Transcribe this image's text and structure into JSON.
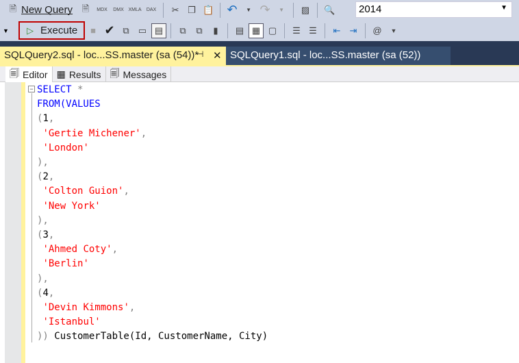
{
  "toolbar": {
    "new_query": "New Query",
    "mdx": "MDX",
    "dmx": "DMX",
    "xmla": "XMLA",
    "dax": "DAX",
    "database": "2014",
    "execute": "Execute"
  },
  "tabs": [
    {
      "label": "SQLQuery2.sql - loc...SS.master (sa (54))*",
      "active": true
    },
    {
      "label": "SQLQuery1.sql - loc...SS.master (sa (52))",
      "active": false
    }
  ],
  "subtabs": [
    "Editor",
    "Results",
    "Messages"
  ],
  "code": {
    "l1a": "SELECT",
    "l1b": " *",
    "l2": "FROM(VALUES",
    "r1id": "1",
    "r1name": "'Gertie Michener'",
    "r1city": "'London'",
    "r2id": "2",
    "r2name": "'Colton Guion'",
    "r2city": "'New York'",
    "r3id": "3",
    "r3name": "'Ahmed Coty'",
    "r3city": "'Berlin'",
    "r4id": "4",
    "r4name": "'Devin Kimmons'",
    "r4city": "'Istanbul'",
    "last": " CustomerTable(Id, CustomerName, City)"
  }
}
